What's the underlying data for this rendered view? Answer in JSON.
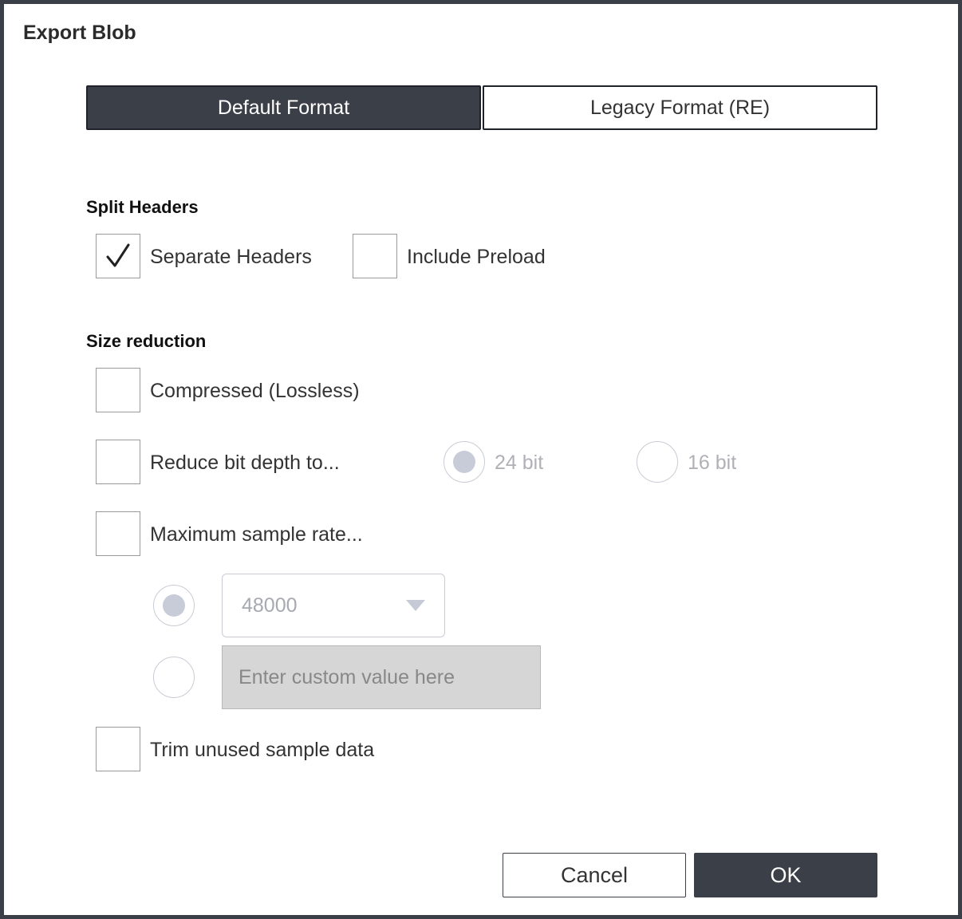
{
  "dialog": {
    "title": "Export Blob"
  },
  "format_tabs": {
    "default_label": "Default Format",
    "legacy_label": "Legacy Format (RE)",
    "selected": "Default Format"
  },
  "split_headers": {
    "title": "Split Headers",
    "separate_headers": {
      "label": "Separate Headers",
      "checked": true
    },
    "include_preload": {
      "label": "Include Preload",
      "checked": false
    }
  },
  "size_reduction": {
    "title": "Size reduction",
    "compressed": {
      "label": "Compressed (Lossless)",
      "checked": false
    },
    "reduce_bit_depth": {
      "label": "Reduce bit depth to...",
      "checked": false,
      "options": [
        "24 bit",
        "16 bit"
      ],
      "selected": "24 bit"
    },
    "max_sample_rate": {
      "label": "Maximum sample rate...",
      "checked": false,
      "preset_value": "48000",
      "custom_placeholder": "Enter custom value here",
      "selected_option": "preset"
    },
    "trim_unused": {
      "label": "Trim unused sample data",
      "checked": false
    }
  },
  "footer": {
    "cancel_label": "Cancel",
    "ok_label": "OK"
  },
  "icons": {
    "checkmark": "checkmark-icon",
    "dropdown": "chevron-down-icon"
  },
  "colors": {
    "primary": "#3b3f48",
    "disabled_text": "#b0b0b6",
    "input_disabled_bg": "#d6d6d6"
  }
}
